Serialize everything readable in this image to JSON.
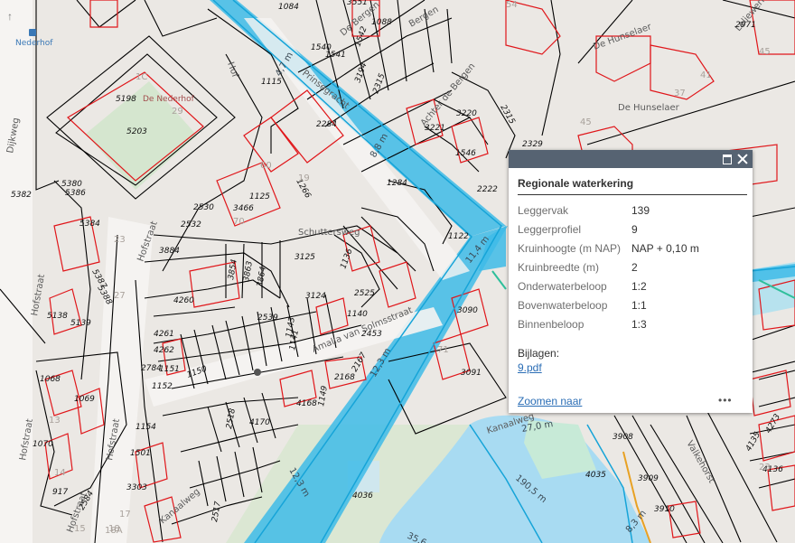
{
  "map": {
    "place_label": "Nederhof",
    "streets": [
      "Dijkweg",
      "Hofstraat",
      "Hofstraat",
      "Hofstraat",
      "Hofstraat",
      "Hofstraat",
      "Prinsegracht",
      "De Nederhof",
      "Amalia van Solmsstraat",
      "De Hunselaer",
      "De Hunselaer",
      "Leliewerkstraat",
      "Valkehorst",
      "Kanaalweg",
      "Kanaalweg",
      "Schuttersweg",
      "Hof",
      "Bergen",
      "De Bergen",
      "Achter de Bergen"
    ],
    "parcels": [
      "5203",
      "5382",
      "5384",
      "5380",
      "5386",
      "5138",
      "5139",
      "5387",
      "5388",
      "1068",
      "1069",
      "1070",
      "1501",
      "917",
      "2584",
      "1154",
      "1151",
      "1152",
      "1150",
      "2784",
      "4262",
      "4261",
      "4260",
      "3884",
      "2532",
      "2530",
      "3466",
      "1125",
      "1266",
      "2284",
      "1115",
      "5198",
      "1540",
      "1541",
      "1542",
      "1088",
      "1084",
      "3551",
      "3194",
      "2315",
      "3220",
      "3221",
      "1546",
      "2329",
      "2222",
      "1284",
      "1122",
      "3125",
      "3124",
      "2525",
      "1136",
      "3864",
      "3863",
      "3854",
      "2539",
      "1140",
      "1141",
      "2453",
      "2167",
      "2168",
      "4168",
      "4170",
      "2518",
      "2517",
      "1149",
      "3090",
      "3091",
      "4036",
      "4035",
      "3908",
      "3909",
      "3910",
      "4135",
      "4136",
      "4273",
      "2971",
      "1143",
      "2315",
      "3303"
    ],
    "gray_numbers": [
      "1C",
      "29",
      "37",
      "41",
      "60",
      "70",
      "71",
      "13",
      "14",
      "15",
      "17",
      "18",
      "18A",
      "19",
      "23",
      "45",
      "54",
      "27",
      "45",
      "23"
    ],
    "water_labels": [
      "11,4 m",
      "12,3 m",
      "12,3 m",
      "27,0 m",
      "190,5 m",
      "35,6 m",
      "8,3 m",
      "4,7 m",
      "8,8 m"
    ]
  },
  "popup": {
    "title": "Regionale waterkering",
    "attributes": [
      {
        "label": "Leggervak",
        "value": "139"
      },
      {
        "label": "Leggerprofiel",
        "value": "9"
      },
      {
        "label": "Kruinhoogte (m NAP)",
        "value": "NAP + 0,10 m"
      },
      {
        "label": "Kruinbreedte (m)",
        "value": "2"
      },
      {
        "label": "Onderwaterbeloop",
        "value": "1:2"
      },
      {
        "label": "Bovenwaterbeloop",
        "value": "1:1"
      },
      {
        "label": "Binnenbeloop",
        "value": "1:3"
      }
    ],
    "attachments_label": "Bijlagen:",
    "attachment": "9.pdf",
    "zoom_label": "Zoomen naar",
    "more_label": "•••"
  },
  "colors": {
    "background": "#ebe8e4",
    "water": "#b9e3f3",
    "waterkering": "#3ebbe7",
    "parcel_line": "#000000",
    "building_line": "#e0161a",
    "popup_header": "#566372",
    "link": "#2a6db5"
  }
}
